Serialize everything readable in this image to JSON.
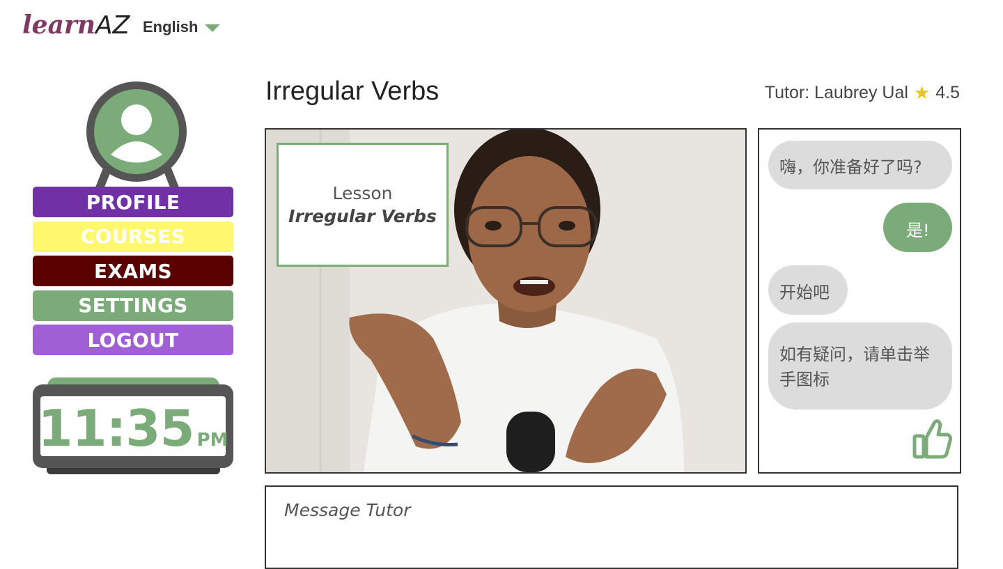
{
  "header": {
    "logo_learn": "learn",
    "logo_az": "AZ",
    "language": "English"
  },
  "nav": {
    "profile": "PROFILE",
    "courses": "COURSES",
    "exams": "EXAMS",
    "settings": "SETTINGS",
    "logout": "LOGOUT"
  },
  "clock": {
    "time": "11:35",
    "ampm": "PM"
  },
  "lesson": {
    "title": "Irregular Verbs",
    "tutor_label": "Tutor: Laubrey Ual",
    "rating": "4.5",
    "card_label": "Lesson",
    "card_name": "Irregular Verbs"
  },
  "chat": {
    "messages": [
      {
        "side": "left",
        "text": "嗨，你准备好了吗?"
      },
      {
        "side": "right",
        "text": "是!"
      },
      {
        "side": "left",
        "text": "开始吧"
      },
      {
        "side": "left",
        "text": "如有疑问，请单击举手图标"
      }
    ]
  },
  "compose": {
    "placeholder": "Message Tutor"
  },
  "colors": {
    "accent_green": "#7aab79",
    "purple": "#7030a6",
    "yellow": "#fff86e",
    "maroon": "#5a0000",
    "lavender": "#a15fd6",
    "logo_plum": "#7e3a63"
  }
}
